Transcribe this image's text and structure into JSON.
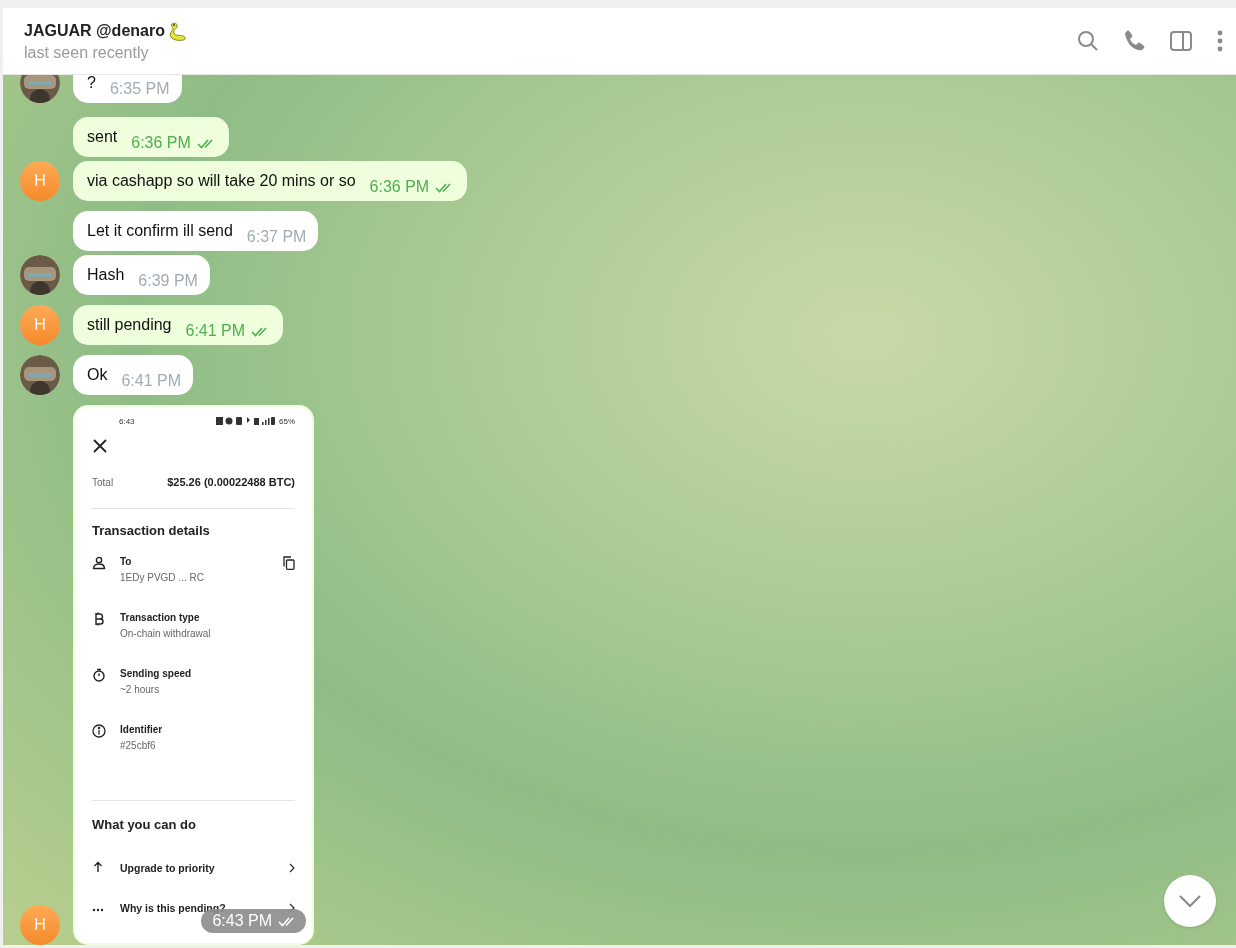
{
  "header": {
    "title": "JAGUAR @denaro",
    "status": "last seen recently"
  },
  "messages": [
    {
      "kind": "text",
      "outgoing": false,
      "text": "?",
      "time": "6:35 PM",
      "read": false,
      "avatar": {
        "kind": "photo"
      }
    },
    {
      "kind": "text",
      "outgoing": true,
      "text": "sent",
      "time": "6:36 PM",
      "read": true
    },
    {
      "kind": "text",
      "outgoing": true,
      "text": "via cashapp so will take 20 mins or so",
      "time": "6:36 PM",
      "read": true,
      "avatar": {
        "kind": "letter",
        "letter": "H"
      }
    },
    {
      "kind": "text",
      "outgoing": false,
      "text": "Let it confirm ill send",
      "time": "6:37 PM",
      "read": false
    },
    {
      "kind": "text",
      "outgoing": false,
      "text": "Hash",
      "time": "6:39 PM",
      "read": false,
      "avatar": {
        "kind": "photo"
      }
    },
    {
      "kind": "text",
      "outgoing": true,
      "text": "still pending",
      "time": "6:41 PM",
      "read": true,
      "avatar": {
        "kind": "letter",
        "letter": "H"
      }
    },
    {
      "kind": "text",
      "outgoing": false,
      "text": "Ok",
      "time": "6:41 PM",
      "read": false,
      "avatar": {
        "kind": "photo"
      }
    },
    {
      "kind": "screenshot",
      "outgoing": true,
      "time": "6:43 PM",
      "read": true,
      "avatar": {
        "kind": "letter",
        "letter": "H"
      },
      "screenshot": {
        "status_time": "6:43",
        "battery": "65%",
        "total_label": "Total",
        "total_value": "$25.26 (0.00022488 BTC)",
        "details_title": "Transaction details",
        "details": [
          {
            "kind": "person",
            "label": "To",
            "value": "1EDy PVGD ... RC",
            "copyable": true
          },
          {
            "kind": "bitcoin",
            "label": "Transaction type",
            "value": "On-chain withdrawal",
            "copyable": false
          },
          {
            "kind": "timer",
            "label": "Sending speed",
            "value": "~2 hours",
            "copyable": false
          },
          {
            "kind": "info",
            "label": "Identifier",
            "value": "#25cbf6",
            "copyable": false
          }
        ],
        "actions_title": "What you can do",
        "actions": [
          {
            "kind": "arrow",
            "label": "Upgrade to priority"
          },
          {
            "kind": "dots",
            "label": "Why is this pending?"
          }
        ]
      }
    }
  ]
}
